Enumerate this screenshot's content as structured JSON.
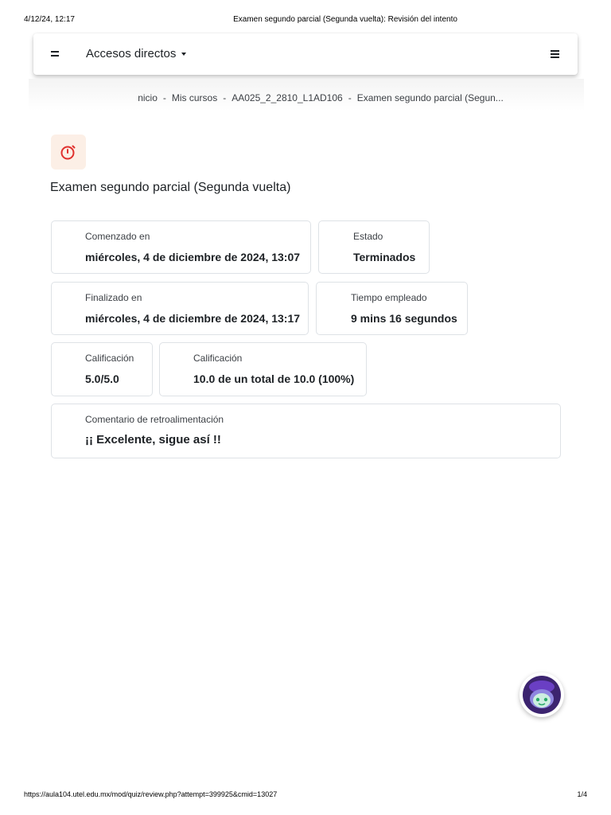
{
  "print_header": {
    "datetime": "4/12/24, 12:17",
    "document_title": "Examen segundo parcial (Segunda vuelta): Revisión del intento"
  },
  "navbar": {
    "shortcuts_label": "Accesos directos",
    "toggle_icon": "hamburger-icon",
    "menu_icon": "list-menu-icon"
  },
  "breadcrumb": {
    "items": [
      "nicio",
      "Mis cursos",
      "AA025_2_2810_L1AD106",
      "Examen segundo parcial (Segun..."
    ],
    "separator": "-"
  },
  "activity": {
    "icon": "stopwatch-icon",
    "icon_color": "#e0312e",
    "icon_bg": "#fcefe6",
    "title": "Examen segundo parcial (Segunda vuelta)"
  },
  "summary": {
    "started": {
      "label": "Comenzado en",
      "value": "miércoles, 4 de diciembre de 2024, 13:07"
    },
    "state": {
      "label": "Estado",
      "value": "Terminados"
    },
    "completed": {
      "label": "Finalizado en",
      "value": "miércoles, 4 de diciembre de 2024, 13:17"
    },
    "time_taken": {
      "label": "Tiempo empleado",
      "value": "9 mins 16 segundos"
    },
    "marks": {
      "label": "Calificación",
      "value": "5.0/5.0"
    },
    "grade": {
      "label": "Calificación",
      "value": "10.0 de un total de 10.0 (100%)"
    },
    "feedback": {
      "label": "Comentario de retroalimentación",
      "value": "¡¡ Excelente, sigue así !!"
    }
  },
  "chat_assistant": {
    "icon": "chatbot-avatar-icon"
  },
  "print_footer": {
    "url": "https://aula104.utel.edu.mx/mod/quiz/review.php?attempt=399925&cmid=13027",
    "page": "1/4"
  }
}
